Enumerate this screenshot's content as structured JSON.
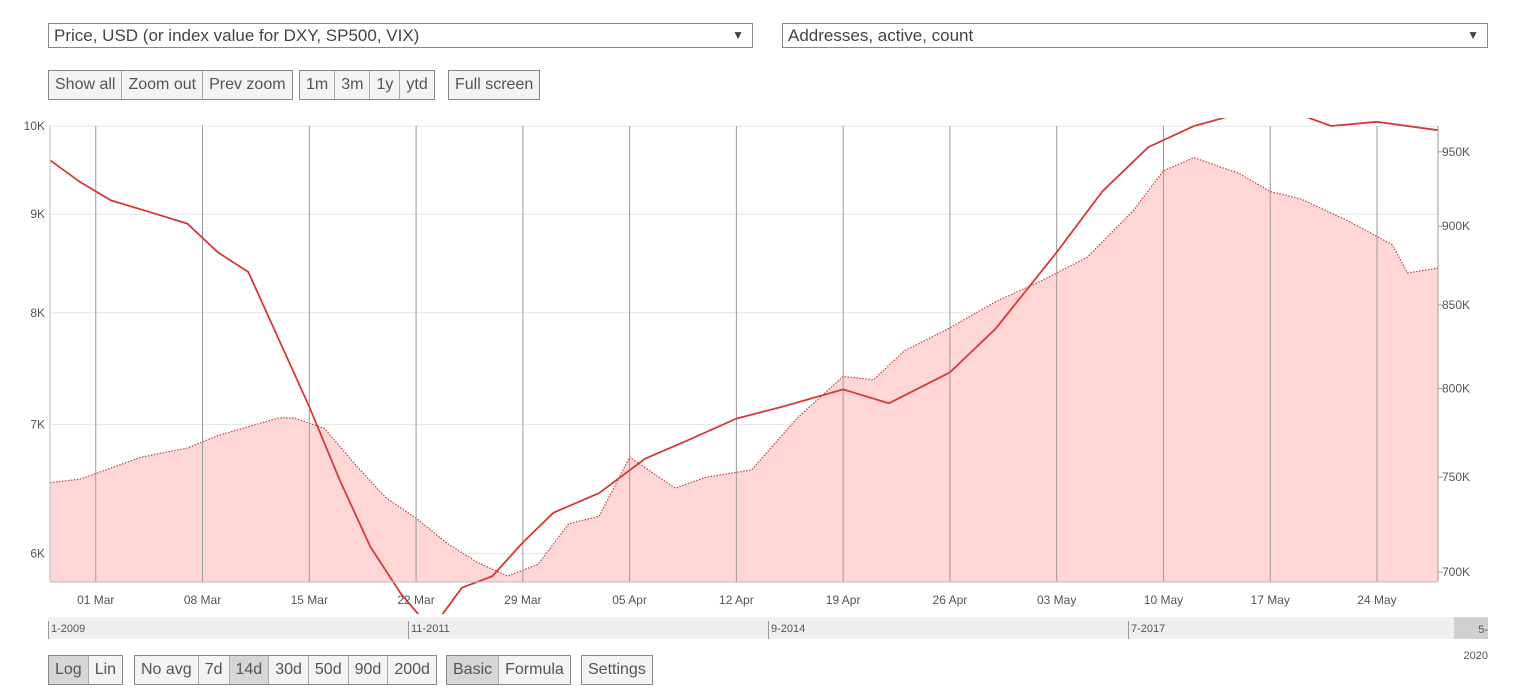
{
  "selectors": {
    "left": "Price, USD (or index value for DXY, SP500, VIX)",
    "right": "Addresses, active, count",
    "arrow": "▼"
  },
  "zoom_buttons": {
    "group1": [
      "Show all",
      "Zoom out",
      "Prev zoom"
    ],
    "group2": [
      "1m",
      "3m",
      "1y",
      "ytd"
    ],
    "group3": [
      "Full screen"
    ]
  },
  "bottom_buttons": {
    "scale": [
      "Log",
      "Lin"
    ],
    "avg": [
      "No avg",
      "7d",
      "14d",
      "30d",
      "50d",
      "90d",
      "200d"
    ],
    "mode": [
      "Basic",
      "Formula"
    ],
    "settings": [
      "Settings"
    ]
  },
  "active_buttons": [
    "Log",
    "14d",
    "Basic"
  ],
  "navigator": {
    "labels": [
      "1-2009",
      "11-2011",
      "9-2014",
      "7-2017",
      "5-2020"
    ]
  },
  "colors": {
    "price_line": "#d33a3a",
    "area_fill": "#ffd6d6",
    "area_stroke": "#c44444",
    "grid": "#e4e4e4",
    "vgrid": "#9a9a9a"
  },
  "chart_data": {
    "type": "line",
    "x_start": "2020-02-27",
    "x_end": "2020-05-28",
    "x_tick_labels": [
      "01 Mar",
      "08 Mar",
      "15 Mar",
      "22 Mar",
      "29 Mar",
      "05 Apr",
      "12 Apr",
      "19 Apr",
      "26 Apr",
      "03 May",
      "10 May",
      "17 May",
      "24 May"
    ],
    "y_left": {
      "label": "Price, USD",
      "scale": "log",
      "ticks": [
        "6K",
        "7K",
        "8K",
        "9K",
        "10K"
      ],
      "range": [
        5800,
        10000
      ]
    },
    "y_right": {
      "label": "Addresses, active, count",
      "scale": "log",
      "ticks": [
        "700K",
        "750K",
        "800K",
        "850K",
        "900K",
        "950K"
      ],
      "range": [
        695000,
        968000
      ]
    },
    "grid": true,
    "series": [
      {
        "name": "Price, USD",
        "axis": "left",
        "style": "line",
        "dates": [
          "2020-02-27",
          "2020-02-29",
          "2020-03-02",
          "2020-03-05",
          "2020-03-07",
          "2020-03-09",
          "2020-03-11",
          "2020-03-13",
          "2020-03-15",
          "2020-03-17",
          "2020-03-19",
          "2020-03-21",
          "2020-03-23",
          "2020-03-25",
          "2020-03-27",
          "2020-03-29",
          "2020-03-31",
          "2020-04-03",
          "2020-04-06",
          "2020-04-09",
          "2020-04-12",
          "2020-04-15",
          "2020-04-19",
          "2020-04-22",
          "2020-04-26",
          "2020-04-29",
          "2020-05-03",
          "2020-05-06",
          "2020-05-09",
          "2020-05-12",
          "2020-05-15",
          "2020-05-18",
          "2020-05-21",
          "2020-05-24",
          "2020-05-28"
        ],
        "values": [
          9600,
          9350,
          9150,
          9000,
          8900,
          8600,
          8400,
          7750,
          7150,
          6550,
          6050,
          5720,
          5480,
          5760,
          5840,
          6080,
          6300,
          6450,
          6720,
          6880,
          7050,
          7150,
          7300,
          7180,
          7450,
          7850,
          8600,
          9250,
          9750,
          10000,
          10150,
          10200,
          10000,
          10050,
          9950
        ]
      },
      {
        "name": "Addresses, active, count",
        "axis": "right",
        "style": "area",
        "dates": [
          "2020-02-27",
          "2020-02-29",
          "2020-03-02",
          "2020-03-04",
          "2020-03-07",
          "2020-03-09",
          "2020-03-11",
          "2020-03-13",
          "2020-03-14",
          "2020-03-16",
          "2020-03-18",
          "2020-03-20",
          "2020-03-22",
          "2020-03-24",
          "2020-03-26",
          "2020-03-28",
          "2020-03-30",
          "2020-04-01",
          "2020-04-03",
          "2020-04-05",
          "2020-04-08",
          "2020-04-10",
          "2020-04-13",
          "2020-04-16",
          "2020-04-19",
          "2020-04-21",
          "2020-04-23",
          "2020-04-26",
          "2020-04-29",
          "2020-05-02",
          "2020-05-05",
          "2020-05-08",
          "2020-05-10",
          "2020-05-12",
          "2020-05-15",
          "2020-05-17",
          "2020-05-19",
          "2020-05-22",
          "2020-05-25",
          "2020-05-26",
          "2020-05-28"
        ],
        "values": [
          747000,
          749000,
          755000,
          761000,
          766000,
          773000,
          778000,
          783000,
          783000,
          777000,
          757000,
          739000,
          728000,
          715000,
          705000,
          698000,
          704000,
          725000,
          729000,
          761000,
          744000,
          750000,
          754000,
          783000,
          807000,
          805000,
          822000,
          836000,
          852000,
          865000,
          880000,
          910000,
          937000,
          946000,
          935000,
          923000,
          918000,
          904000,
          888000,
          870000,
          873000
        ]
      }
    ]
  }
}
